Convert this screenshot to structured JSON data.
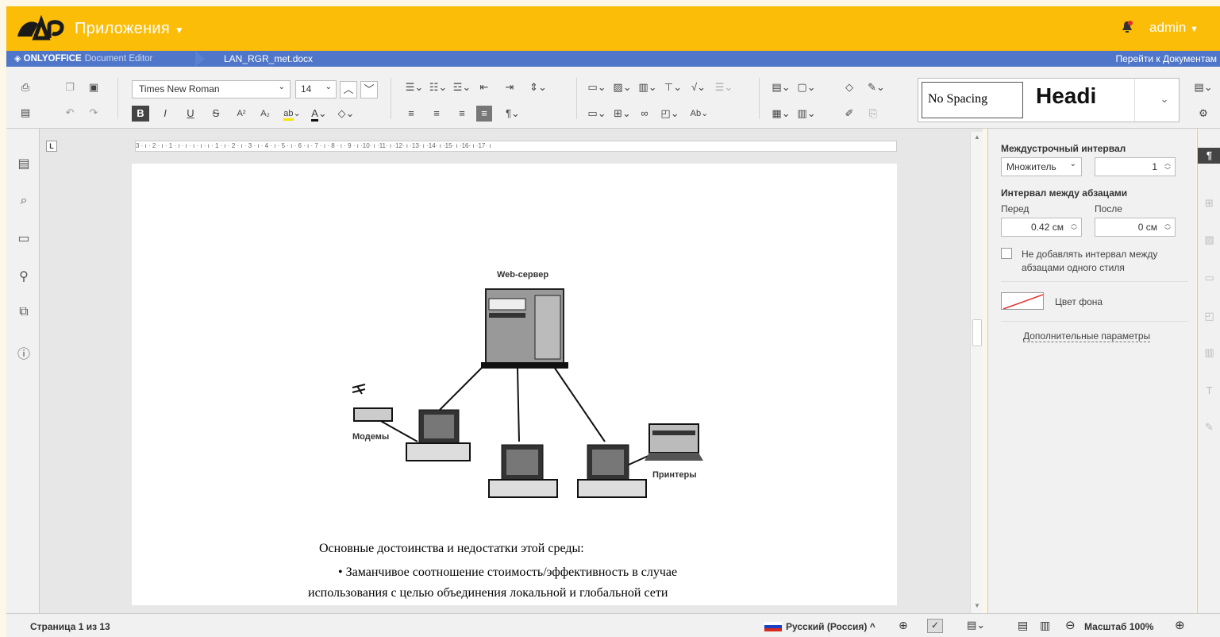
{
  "header": {
    "apps_label": "Приложения",
    "user": "admin"
  },
  "titlebar": {
    "brand": "ONLYOFFICE",
    "brand_sub": "Document Editor",
    "filename": "LAN_RGR_met.docx",
    "goto_docs": "Перейти к Документам"
  },
  "toolbar": {
    "font_name": "Times New Roman",
    "font_size": "14",
    "styles": [
      "No Spacing",
      "Headi"
    ]
  },
  "ruler": {
    "ticks": "3 · ı · 2 · ı · 1 · ı · ı · ı · ı · ı · 1 · ı · 2 · ı · 3 · ı · 4 · ı · 5 · ı · 6 · ı · 7 · ı · 8 · ı · 9 · ı ·10· ı ·11· ı ·12· ı ·13· ı ·14· ı ·15· ı ·16· ı ·17· ı"
  },
  "document": {
    "figure_labels": {
      "server": "Web-сервер",
      "modems": "Модемы",
      "printers": "Принтеры"
    },
    "para1": "Основные достоинства и недостатки этой среды:",
    "para2": "• Заманчивое соотношение стоимость/эффективность в случае",
    "para3": "использования с целью объединения локальной и глобальной сети"
  },
  "right_panel": {
    "line_spacing_label": "Междустрочный интервал",
    "line_spacing_mode": "Множитель",
    "line_spacing_value": "1",
    "para_spacing_label": "Интервал между абзацами",
    "before_label": "Перед",
    "after_label": "После",
    "before_value": "0.42 см",
    "after_value": "0 см",
    "no_interval_label_1": "Не добавлять интервал между",
    "no_interval_label_2": "абзацами одного стиля",
    "bg_color_label": "Цвет фона",
    "advanced_link": "Дополнительные параметры"
  },
  "statusbar": {
    "page_info": "Страница 1 из 13",
    "language": "Русский (Россия)",
    "zoom": "Масштаб 100%"
  },
  "colors": {
    "topbar": "#fbbd08",
    "titlebar": "#4f76c8"
  }
}
